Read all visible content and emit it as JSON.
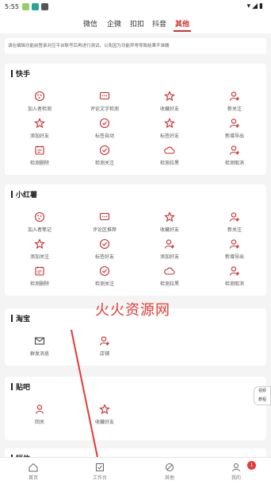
{
  "status_bar": {
    "time": "5:55"
  },
  "top_tabs": [
    "微信",
    "企微",
    "扣扣",
    "抖音",
    "其他"
  ],
  "active_tab": "其他",
  "notice": "请在编辑功能前登录对应平台账号后再进行测试，以免因为功能异常导致结果不准确",
  "sections": [
    {
      "title": "快手",
      "items": [
        "加入者检测",
        "评论文字检测",
        "收藏好友",
        "新关注",
        "添加好友",
        "标签自动",
        "标签好友",
        "新增导出",
        "检测删除",
        "检测关注",
        "检测拉黑",
        "检测取消"
      ]
    },
    {
      "title": "小红薯",
      "items": [
        "加入者笔记",
        "评论区推荐",
        "收藏好友",
        "新关注",
        "添加关注",
        "标签好友",
        "添加好友",
        "新增导出",
        "检测删除",
        "检测关注",
        "检测拉黑",
        "检测取消"
      ]
    },
    {
      "title": "淘宝",
      "items": [
        "群发消息",
        "店铺"
      ]
    },
    {
      "title": "贴吧",
      "items": [
        "回关",
        "收藏好友"
      ]
    },
    {
      "title": "短信",
      "items": []
    }
  ],
  "watermark": "火火资源网",
  "side_button": {
    "line1": "视频",
    "line2": "教程"
  },
  "bottom_nav": [
    "首页",
    "工作台",
    "其他",
    "我的"
  ],
  "badge_count": "1",
  "colors": {
    "accent": "#d32f2f",
    "icon": "#c62828"
  }
}
